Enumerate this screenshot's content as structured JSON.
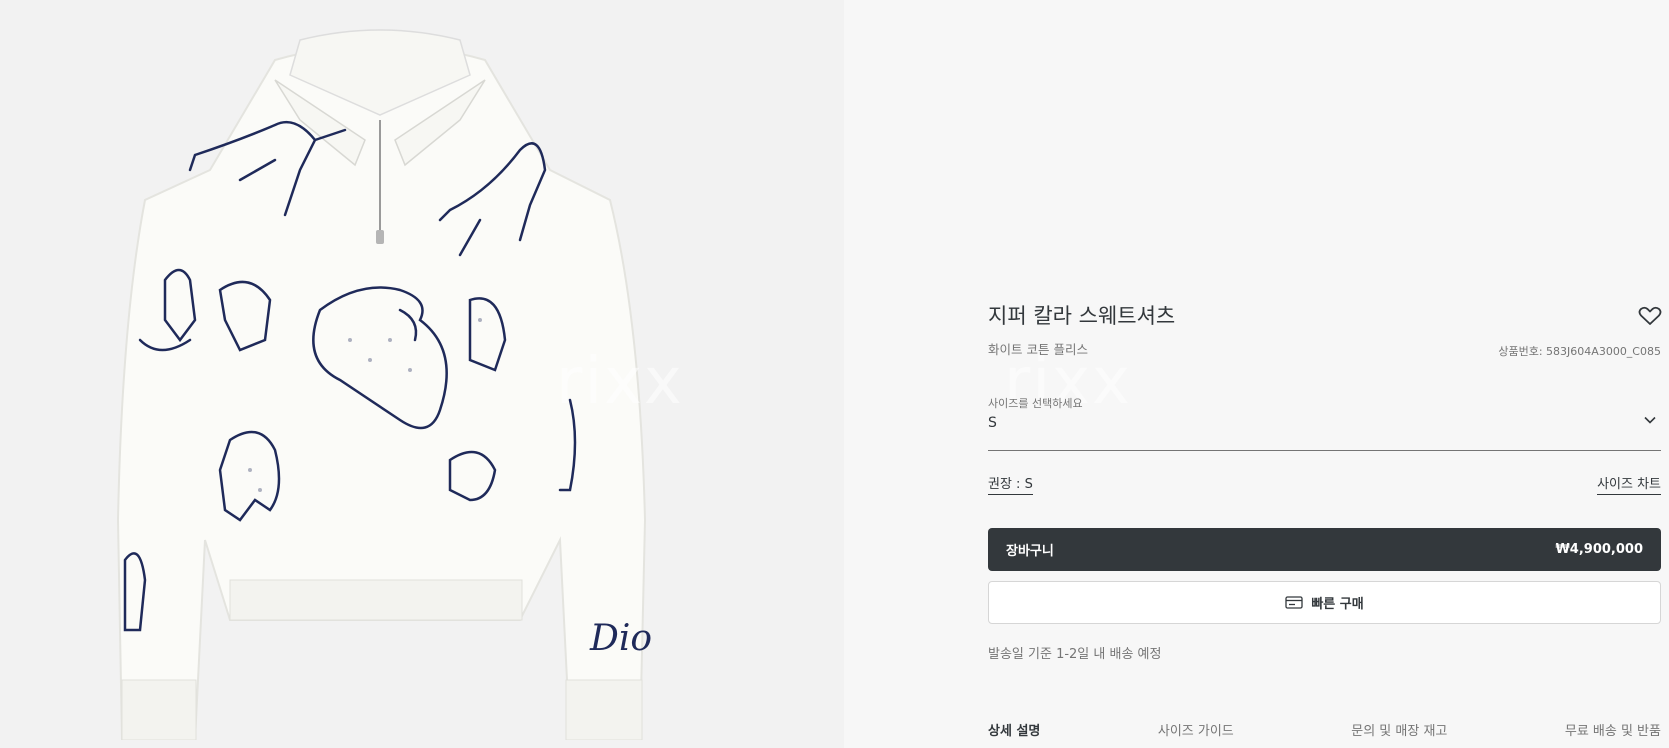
{
  "watermarks": {
    "left": "rixx",
    "right": "rixx"
  },
  "product_image_alt": "",
  "product": {
    "title": "지퍼 칼라 스웨트셔츠",
    "subtitle": "화이트 코튼 플리스",
    "reference": "상품번호: 583J604A3000_C085",
    "wishlist_icon": "heart-icon"
  },
  "size_selector": {
    "label": "사이즈를 선택하세요",
    "value": "S",
    "icon": "chevron-down-icon"
  },
  "recommendation": {
    "text": "권장 : S"
  },
  "size_chart": {
    "label": "사이즈 차트"
  },
  "cart_button": {
    "label": "장바구니",
    "price": "₩4,900,000"
  },
  "quick_buy": {
    "label": "빠른 구매",
    "icon": "card-icon"
  },
  "shipping_note": "발송일 기준 1-2일 내 배송 예정",
  "tabs": [
    {
      "label": "상세 설명",
      "active": true
    },
    {
      "label": "사이즈 가이드",
      "active": false
    },
    {
      "label": "문의 및 매장 재고",
      "active": false
    },
    {
      "label": "무료 배송 및 반품",
      "active": false
    }
  ],
  "image_text": {
    "brand_script": "Dio"
  },
  "colors": {
    "primary_button": "#33383c",
    "page_bg": "#f7f7f7",
    "image_bg": "#f2f2f2",
    "embroidery": "#1f2a5a"
  }
}
